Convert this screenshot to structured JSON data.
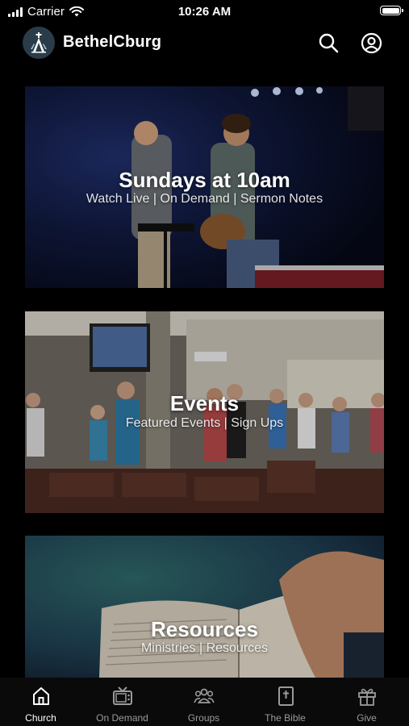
{
  "status_bar": {
    "carrier": "Carrier",
    "time": "10:26 AM"
  },
  "header": {
    "title": "BethelCburg"
  },
  "cards": [
    {
      "title": "Sundays at 10am",
      "subtitle": "Watch Live | On Demand | Sermon Notes"
    },
    {
      "title": "Events",
      "subtitle": "Featured Events | Sign Ups"
    },
    {
      "title": "Resources",
      "subtitle": "Ministries | Resources"
    }
  ],
  "tabs": [
    {
      "label": "Church",
      "icon": "home-icon",
      "active": true
    },
    {
      "label": "On Demand",
      "icon": "tv-icon",
      "active": false
    },
    {
      "label": "Groups",
      "icon": "groups-icon",
      "active": false
    },
    {
      "label": "The Bible",
      "icon": "bible-icon",
      "active": false
    },
    {
      "label": "Give",
      "icon": "gift-icon",
      "active": false
    }
  ],
  "colors": {
    "background": "#000000",
    "logo_bg": "#2a3c4a",
    "tab_inactive": "#9a9a9a",
    "tab_active": "#ffffff"
  }
}
